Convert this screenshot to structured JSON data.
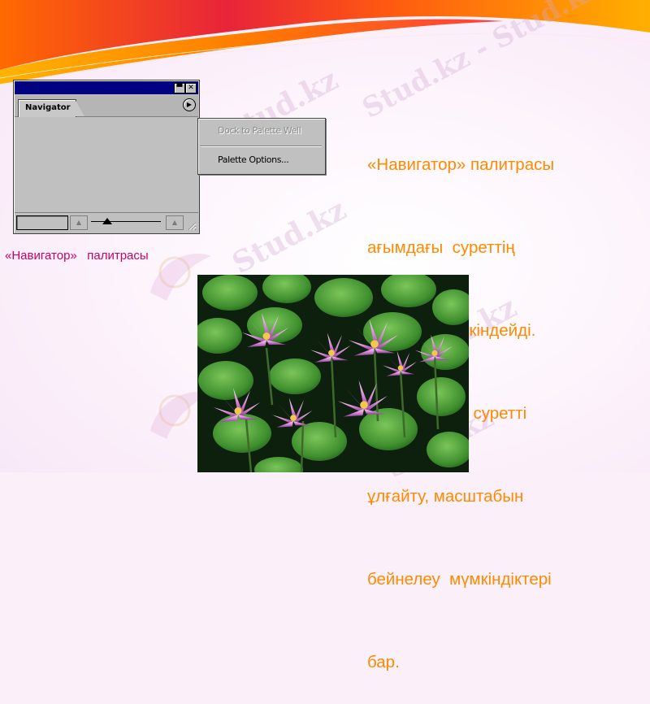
{
  "slide": {
    "description_lines": [
      "«Навигатор» палитрасы",
      "ағымдағы  суреттің",
      "бейнесін  кескіндейді.",
      "Палитраның  суретті",
      "ұлғайту, масштабын",
      "бейнелеу  мүмкіндіктері",
      "бар."
    ],
    "caption": "«Навигатор»   палитрасы",
    "watermark_text": "Stud.kz"
  },
  "palette": {
    "tab_label": "Navigator",
    "title_buttons": {
      "minimize_glyph": "▀",
      "close_glyph": "✕"
    },
    "menu_arrow_glyph": "▶",
    "footer": {
      "zoom_value": "",
      "zoom_out_glyph": "▲",
      "zoom_in_glyph": "▲"
    }
  },
  "flyout_menu": {
    "items": [
      {
        "label": "Dock to Palette Well",
        "enabled": false
      },
      {
        "label": "Palette Options...",
        "enabled": true
      }
    ]
  },
  "colors": {
    "caption": "#cc0066",
    "description": "#ff8a00",
    "title_bar": "#000080",
    "panel_gray": "#c0c0c0"
  },
  "icons": [
    "minimize-icon",
    "close-icon",
    "palette-menu-arrow-icon",
    "zoom-out-icon",
    "zoom-in-icon",
    "resize-grip-icon"
  ]
}
